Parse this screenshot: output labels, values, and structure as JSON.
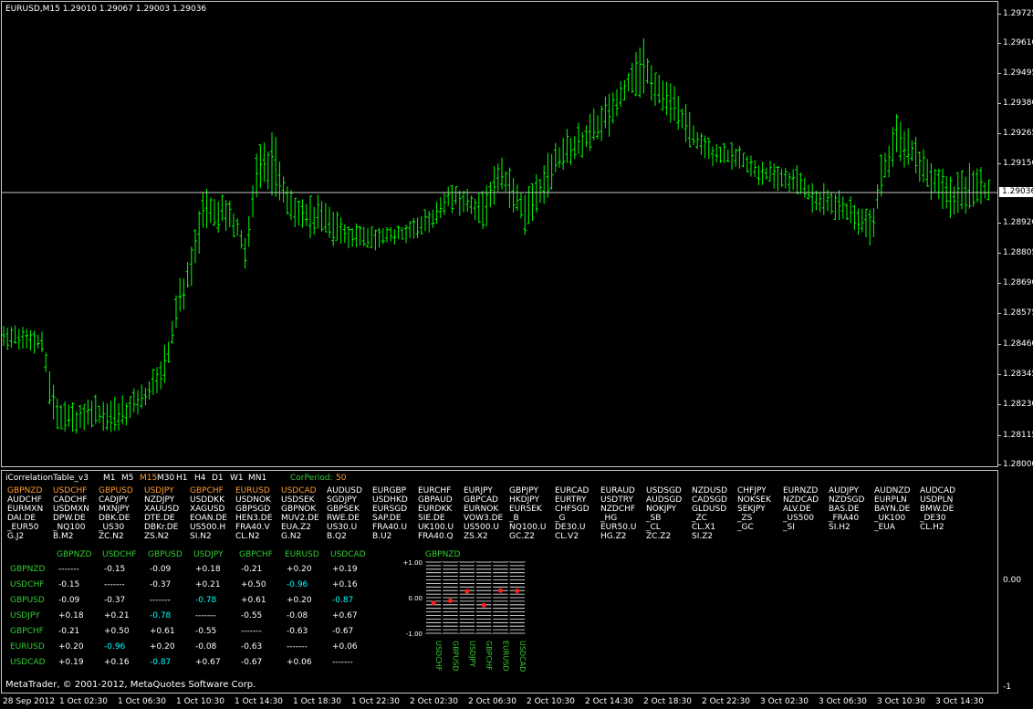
{
  "colors": {
    "background": "#000000",
    "bar": "#00ff00",
    "frame": "#c8c8c8",
    "highlight_orange": "#ff9933",
    "green_text": "#33cc33",
    "cyan": "#00ffff",
    "red_marker": "#ff2020"
  },
  "main_chart": {
    "header": "EURUSD,M15  1.29010 1.29067 1.29003 1.29036",
    "price_labels": [
      "1.29725",
      "1.29610",
      "1.29495",
      "1.29380",
      "1.29265",
      "1.29150",
      "1.29036",
      "1.28920",
      "1.28805",
      "1.28690",
      "1.28575",
      "1.28460",
      "1.28345",
      "1.28230",
      "1.28115",
      "1.28000"
    ],
    "current_price": "1.29036",
    "ylim": [
      1.28,
      1.29725
    ]
  },
  "indicator": {
    "name": "iCorrelationTable_v3",
    "timeframes": [
      "M1",
      "M5",
      "M15",
      "M30",
      "H1",
      "H4",
      "D1",
      "W1",
      "MN1"
    ],
    "active_timeframe": "M15",
    "corperiod_label": "CorPeriod:",
    "corperiod_value": "50",
    "scale_labels": [
      "0.00",
      "-1"
    ],
    "symbol_columns": [
      {
        "head": "GBPNZD",
        "items": [
          "AUDCHF",
          "EURMXN",
          "DAI.DE",
          "_EUR50",
          "G.J2"
        ]
      },
      {
        "head": "USDCHF",
        "items": [
          "CADCHF",
          "USDMXN",
          "DPW.DE",
          "_NQ100",
          "B.M2"
        ]
      },
      {
        "head": "GBPUSD",
        "items": [
          "CADJPY",
          "MXNJPY",
          "DBK.DE",
          "_US30",
          "ZC.N2"
        ]
      },
      {
        "head": "USDJPY",
        "items": [
          "NZDJPY",
          "XAUUSD",
          "DTE.DE",
          "DBKr.DE",
          "ZS.N2"
        ]
      },
      {
        "head": "GBPCHF",
        "items": [
          "USDDKK",
          "XAGUSD",
          "EOAN.DE",
          "US500.H",
          "SI.N2"
        ]
      },
      {
        "head": "EURUSD",
        "items": [
          "USDNOK",
          "GBPSGD",
          "HEN3.DE",
          "FRA40.V",
          "CL.N2"
        ]
      },
      {
        "head": "USDCAD",
        "items": [
          "USDSEK",
          "GBPNOK",
          "MUV2.DE",
          "EUA.Z2",
          "G.N2"
        ]
      },
      {
        "head": "AUDUSD",
        "items": [
          "SGDJPY",
          "GBPSEK",
          "RWE.DE",
          "US30.U",
          "B.Q2"
        ]
      },
      {
        "head": "EURGBP",
        "items": [
          "USDHKD",
          "EURSGD",
          "SAP.DE",
          "FRA40.U",
          "B.U2"
        ]
      },
      {
        "head": "EURCHF",
        "items": [
          "GBPAUD",
          "EURDKK",
          "SIE.DE",
          "UK100.U",
          "FRA40.Q"
        ]
      },
      {
        "head": "EURJPY",
        "items": [
          "GBPCAD",
          "EURNOK",
          "VOW3.DE",
          "US500.U",
          "ZS.X2"
        ]
      },
      {
        "head": "GBPJPY",
        "items": [
          "HKDJPY",
          "EURSEK",
          "_B",
          "NQ100.U",
          "GC.Z2"
        ]
      },
      {
        "head": "EURCAD",
        "items": [
          "EURTRY",
          "CHFSGD",
          "_G",
          "DE30.U",
          "CL.V2"
        ]
      },
      {
        "head": "EURAUD",
        "items": [
          "USDTRY",
          "NZDCHF",
          "_HG",
          "EUR50.U",
          "HG.Z2"
        ]
      },
      {
        "head": "USDSGD",
        "items": [
          "AUDSGD",
          "NOKJPY",
          "_SB",
          "_CL",
          "ZC.Z2"
        ]
      },
      {
        "head": "NZDUSD",
        "items": [
          "CADSGD",
          "GLDUSD",
          "_ZC",
          "CL.X1",
          "SI.Z2"
        ]
      },
      {
        "head": "CHFJPY",
        "items": [
          "NOKSEK",
          "SEKJPY",
          "_ZS",
          "_GC",
          ""
        ]
      },
      {
        "head": "EURNZD",
        "items": [
          "NZDCAD",
          "ALV.DE",
          "_US500",
          "_SI",
          ""
        ]
      },
      {
        "head": "AUDJPY",
        "items": [
          "NZDSGD",
          "BAS.DE",
          "_FRA40",
          "SI.H2",
          ""
        ]
      },
      {
        "head": "AUDNZD",
        "items": [
          "EURPLN",
          "BAYN.DE",
          "_UK100",
          "_EUA",
          ""
        ]
      },
      {
        "head": "AUDCAD",
        "items": [
          "USDPLN",
          "BMW.DE",
          "_DE30",
          "CL.H2",
          ""
        ]
      }
    ],
    "highlighted_heads": [
      "GBPNZD",
      "USDCHF",
      "GBPUSD",
      "USDJPY",
      "GBPCHF",
      "EURUSD",
      "USDCAD"
    ],
    "matrix": {
      "columns": [
        "GBPNZD",
        "USDCHF",
        "GBPUSD",
        "USDJPY",
        "GBPCHF",
        "EURUSD",
        "USDCAD"
      ],
      "rows": [
        {
          "name": "GBPNZD",
          "cells": [
            "-------",
            "-0.15",
            "-0.09",
            "+0.18",
            "-0.21",
            "+0.20",
            "+0.19"
          ]
        },
        {
          "name": "USDCHF",
          "cells": [
            "-0.15",
            "-------",
            "-0.37",
            "+0.21",
            "+0.50",
            "-0.96",
            "+0.16"
          ]
        },
        {
          "name": "GBPUSD",
          "cells": [
            "-0.09",
            "-0.37",
            "-------",
            "-0.78",
            "+0.61",
            "+0.20",
            "-0.87"
          ]
        },
        {
          "name": "USDJPY",
          "cells": [
            "+0.18",
            "+0.21",
            "-0.78",
            "-------",
            "-0.55",
            "-0.08",
            "+0.67"
          ]
        },
        {
          "name": "GBPCHF",
          "cells": [
            "-0.21",
            "+0.50",
            "+0.61",
            "-0.55",
            "-------",
            "-0.63",
            "-0.67"
          ]
        },
        {
          "name": "EURUSD",
          "cells": [
            "+0.20",
            "-0.96",
            "+0.20",
            "-0.08",
            "-0.63",
            "-------",
            "+0.06"
          ]
        },
        {
          "name": "USDCAD",
          "cells": [
            "+0.19",
            "+0.16",
            "-0.87",
            "+0.67",
            "-0.67",
            "+0.06",
            "-------"
          ]
        }
      ],
      "cyan_cells": [
        "-0.96",
        "-0.78",
        "-0.87"
      ]
    },
    "mini_chart": {
      "title": "GBPNZD",
      "y_labels": [
        "+1.00",
        "0.00",
        "-1.00"
      ],
      "categories": [
        "USDCHF",
        "GBPUSD",
        "USDJPY",
        "GBPCHF",
        "EURUSD",
        "USDCAD"
      ],
      "values": [
        -0.15,
        -0.09,
        0.18,
        -0.21,
        0.2,
        0.19
      ]
    }
  },
  "copyright": "MetaTrader, © 2001-2012, MetaQuotes Software Corp.",
  "time_labels": [
    "28 Sep 2012",
    "1 Oct 02:30",
    "1 Oct 06:30",
    "1 Oct 10:30",
    "1 Oct 14:30",
    "1 Oct 18:30",
    "1 Oct 22:30",
    "2 Oct 02:30",
    "2 Oct 06:30",
    "2 Oct 10:30",
    "2 Oct 14:30",
    "2 Oct 18:30",
    "2 Oct 22:30",
    "3 Oct 02:30",
    "3 Oct 06:30",
    "3 Oct 10:30",
    "3 Oct 14:30"
  ]
}
